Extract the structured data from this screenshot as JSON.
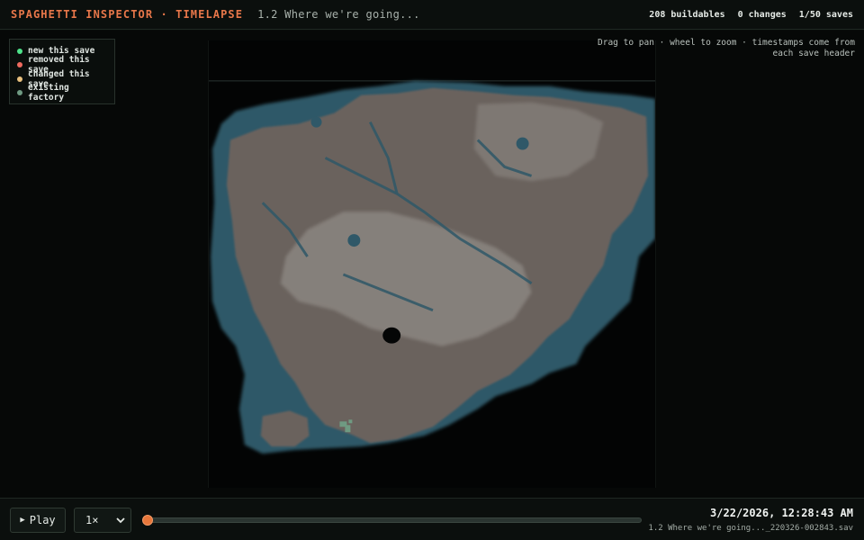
{
  "header": {
    "app_title": "SPAGHETTI INSPECTOR · TIMELAPSE",
    "save_title": "1.2 Where we're going...",
    "stats": {
      "buildables": "208 buildables",
      "changes": "0 changes",
      "saves": "1/50 saves"
    }
  },
  "legend": {
    "items": [
      {
        "label": "new this save",
        "color": "#4ee38a"
      },
      {
        "label": "removed this save",
        "color": "#ef6a5f"
      },
      {
        "label": "changed this save",
        "color": "#e9c07e"
      },
      {
        "label": "existing factory",
        "color": "#6f9a82"
      }
    ]
  },
  "hint": "Drag to pan · wheel to zoom · timestamps come from each save header",
  "map": {
    "water_color": "#2f5868",
    "land_color": "#6a625d",
    "land_light_color": "#8f8a85",
    "factory_color": "#6f9a82"
  },
  "footer": {
    "play_label": "Play",
    "speed_value": "1×",
    "progress": 0,
    "timestamp": "3/22/2026, 12:28:43 AM",
    "filename": "1.2 Where we're going..._220326-002843.sav",
    "accent": "#e8773b"
  }
}
